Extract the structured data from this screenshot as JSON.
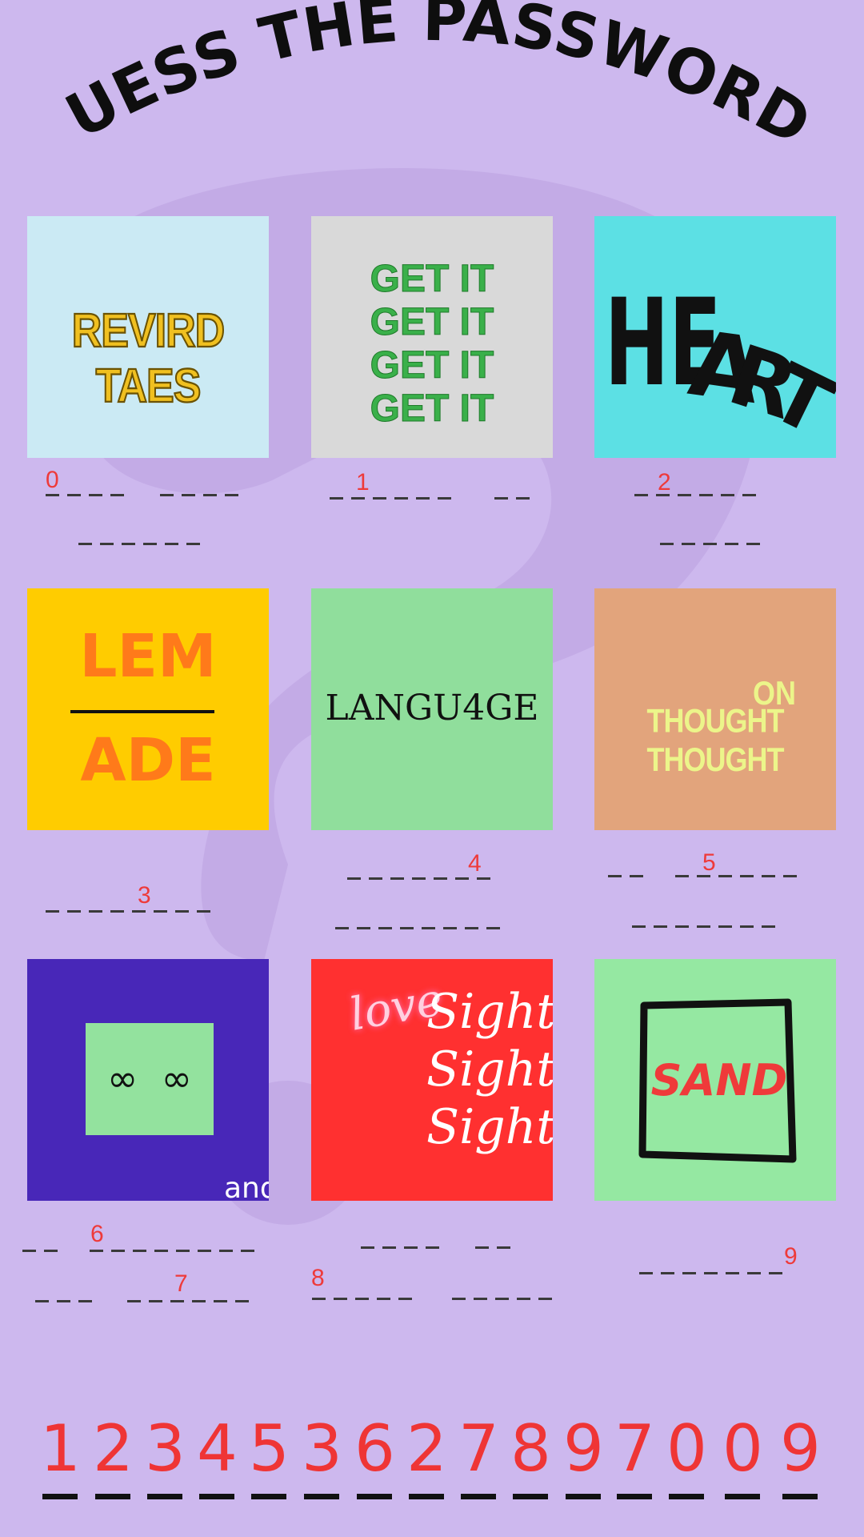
{
  "title": "GUESS THE PASSWORD?",
  "tiles": [
    {
      "text": "REVIRD TAES",
      "bg": "#cbeaf4"
    },
    {
      "lines": [
        "GET IT",
        "GET IT",
        "GET IT",
        "GET IT"
      ],
      "bg": "#d9d9d9"
    },
    {
      "text": "HEART",
      "bg": "#5ce0e4"
    },
    {
      "top": "LEM",
      "bottom": "ADE",
      "bg": "#ffcc00"
    },
    {
      "text": "LANGU4GE",
      "bg": "#90de9c"
    },
    {
      "top": "ON",
      "bottom": "THOUGHT THOUGHT",
      "bg": "#e2a47c"
    },
    {
      "symbol": "∞  ∞",
      "caption": "and",
      "bg": "#4827b8",
      "inner_bg": "#93e29e"
    },
    {
      "script": "love",
      "lines": [
        "Sight",
        "Sight",
        "Sight"
      ],
      "bg": "#ff3030"
    },
    {
      "text": "SAND",
      "bg": "#95e8a2"
    }
  ],
  "hints": [
    "0",
    "1",
    "2",
    "3",
    "4",
    "5",
    "6",
    "7",
    "8",
    "9"
  ],
  "answer": [
    "1",
    "2",
    "3",
    "4",
    "5",
    "3",
    "6",
    "2",
    "7",
    "8",
    "9",
    "7",
    "0",
    "0",
    "9"
  ]
}
